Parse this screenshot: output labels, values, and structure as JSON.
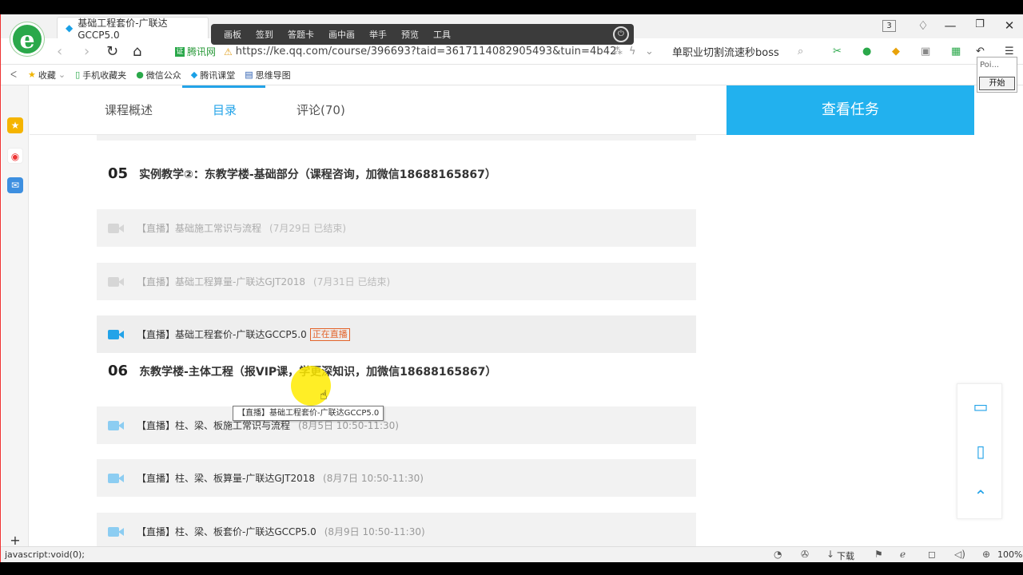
{
  "tabs": [
    {
      "label": "基础工程套价-广联达GCCP5.0",
      "active": true
    },
    {
      "label": "",
      "active": false
    },
    {
      "label": "",
      "active": false
    }
  ],
  "tab_count": "3",
  "annotation_toolbar": {
    "items": [
      "画板",
      "签到",
      "答题卡",
      "画中画",
      "举手",
      "预览",
      "工具"
    ]
  },
  "address_bar": {
    "cert_label": "腾讯网",
    "url": "https://ke.qq.com/course/396693?taid=3617114082905493&tuin=4b42",
    "search_text": "单职业切割流速秒boss"
  },
  "bookmarks": [
    {
      "label": "收藏"
    },
    {
      "label": "手机收藏夹"
    },
    {
      "label": "微信公众"
    },
    {
      "label": "腾讯课堂"
    },
    {
      "label": "思维导图"
    }
  ],
  "popup": {
    "label": "Poi...",
    "button": "开始"
  },
  "course_tabs": [
    {
      "label": "课程概述"
    },
    {
      "label": "目录"
    },
    {
      "label": "评论(70)"
    }
  ],
  "tasks_button": "查看任务",
  "sections": [
    {
      "number": "05",
      "title": "实例教学②：东教学楼-基础部分（课程咨询，加微信18688165867）",
      "lessons": [
        {
          "title": "【直播】基础施工常识与流程",
          "date": "(7月29日 已结束)"
        },
        {
          "title": "【直播】基础工程算量-广联达GJT2018",
          "date": "(7月31日 已结束)"
        },
        {
          "title": "【直播】基础工程套价-广联达GCCP5.0",
          "badge": "正在直播"
        }
      ]
    },
    {
      "number": "06",
      "title": "东教学楼-主体工程（报VIP课，学更深知识，加微信18688165867）",
      "lessons": [
        {
          "title": "【直播】柱、梁、板施工常识与流程",
          "date": "(8月5日 10:50-11:30)"
        },
        {
          "title": "【直播】柱、梁、板算量-广联达GJT2018",
          "date": "(8月7日 10:50-11:30)"
        },
        {
          "title": "【直播】柱、梁、板套价-广联达GCCP5.0",
          "date": "(8月9日 10:50-11:30)"
        }
      ]
    }
  ],
  "tooltip": "【直播】基础工程套价-广联达GCCP5.0",
  "status_bar": {
    "url": "javascript:void(0);",
    "download": "下载",
    "zoom": "100%"
  },
  "colors": {
    "accent": "#23a3e8",
    "tasks_bg": "#22b1ee",
    "live_badge": "#e3642b",
    "logo": "#2aa84a"
  }
}
